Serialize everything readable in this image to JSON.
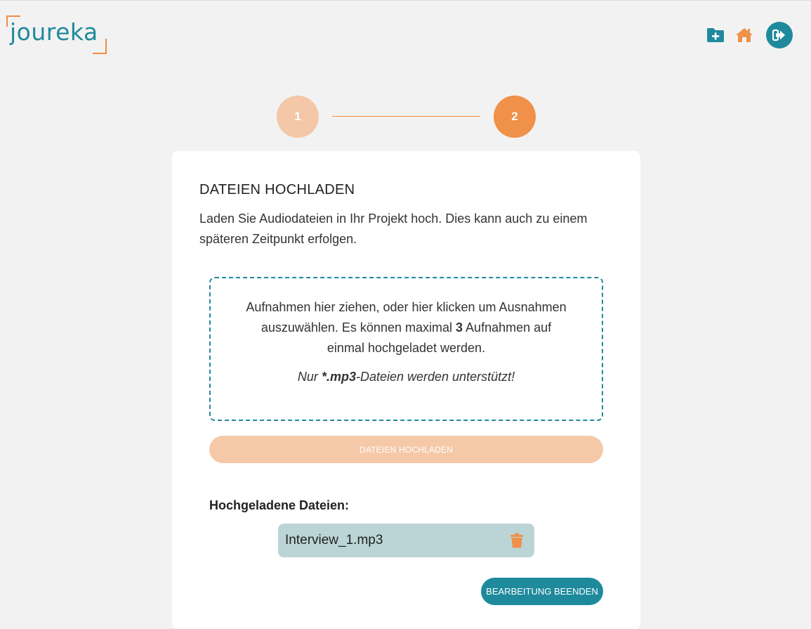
{
  "header": {
    "logo_text": "joureka",
    "icons": [
      "folder-plus-icon",
      "home-icon",
      "logout-icon"
    ]
  },
  "stepper": {
    "steps": [
      "1",
      "2"
    ],
    "current": 2
  },
  "card": {
    "title": "DATEIEN HOCHLADEN",
    "description": "Laden Sie Audiodateien in Ihr Projekt hoch. Dies kann auch zu einem späteren Zeitpunkt erfolgen.",
    "dropzone": {
      "text_part1": "Aufnahmen hier ziehen, oder hier klicken um Ausnahmen auszuwählen. Es können maximal",
      "max_files": "3",
      "text_part2": "Aufnahmen auf einmal hochgeladet werden.",
      "note_prefix": "Nur",
      "note_ext": "*.mp3",
      "note_suffix": "-Dateien werden unterstützt!"
    },
    "upload_button_label": "DATEIEN HOCHLADEN",
    "uploaded_label": "Hochgeladene Dateien:",
    "files": [
      {
        "name": "Interview_1.mp3"
      }
    ],
    "finish_button_label": "BEARBEITUNG BEENDEN"
  },
  "colors": {
    "teal": "#1f8a9c",
    "orange": "#ef9148",
    "orange_light": "#f3c7a7",
    "file_bg": "#bbd5d6",
    "page_bg": "#f2f2f2"
  }
}
